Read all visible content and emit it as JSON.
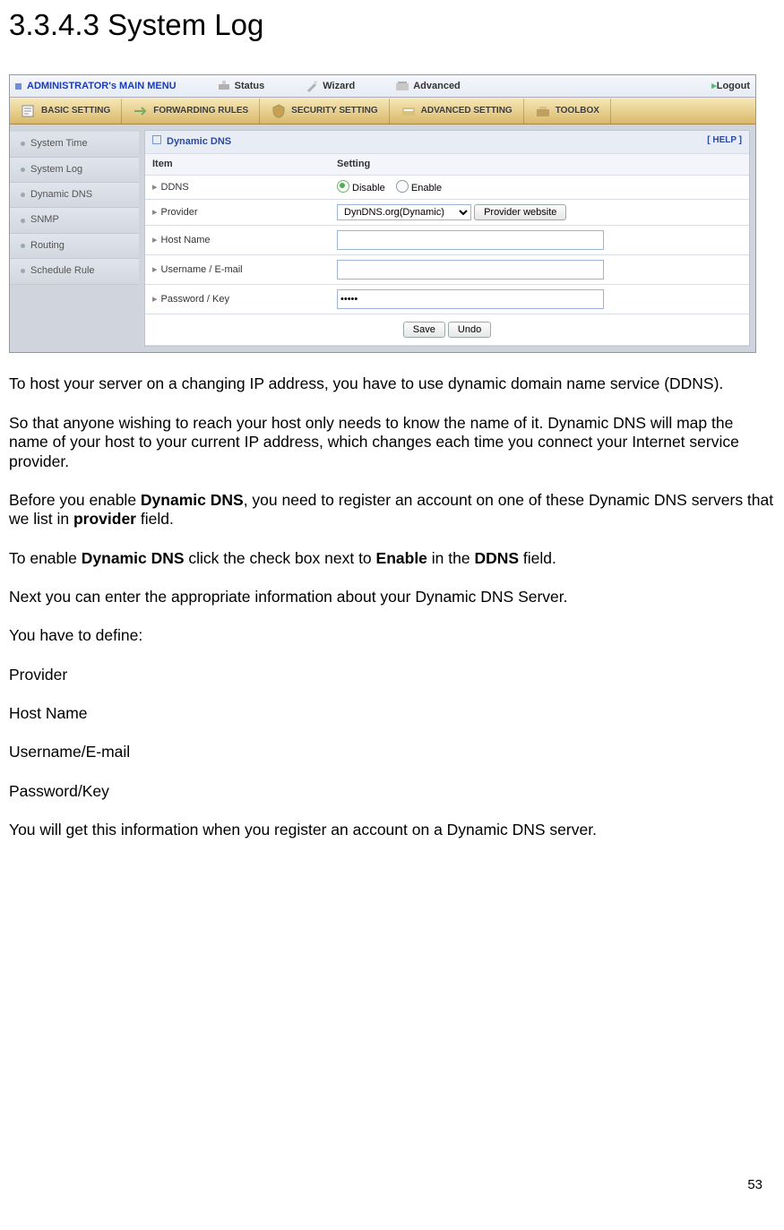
{
  "heading": "3.3.4.3 System Log",
  "topbar": {
    "title": "ADMINISTRATOR's MAIN MENU",
    "nav": {
      "status": "Status",
      "wizard": "Wizard",
      "advanced": "Advanced"
    },
    "logout": "Logout"
  },
  "tabs": {
    "basic": "BASIC SETTING",
    "forwarding": "FORWARDING RULES",
    "security": "SECURITY SETTING",
    "advanced": "ADVANCED SETTING",
    "toolbox": "TOOLBOX"
  },
  "sidebar": {
    "items": [
      "System Time",
      "System Log",
      "Dynamic DNS",
      "SNMP",
      "Routing",
      "Schedule Rule"
    ]
  },
  "panel": {
    "title": "Dynamic DNS",
    "help": "[ HELP ]",
    "col_item": "Item",
    "col_setting": "Setting",
    "rows": {
      "ddns": "DDNS",
      "provider": "Provider",
      "hostname": "Host Name",
      "username": "Username / E-mail",
      "password": "Password / Key"
    },
    "radio_disable": "Disable",
    "radio_enable": "Enable",
    "provider_value": "DynDNS.org(Dynamic)",
    "provider_btn": "Provider website",
    "hostname_value": "",
    "username_value": "",
    "password_value": "•••••",
    "save": "Save",
    "undo": "Undo"
  },
  "prose": {
    "p1": "To host your server on a changing IP address, you have to use dynamic domain name service (DDNS).",
    "p2": "So that anyone wishing to reach your host only needs to know the name of it. Dynamic DNS will map the name of your host to your current IP address, which changes each time you connect your Internet service provider.",
    "p3a": "Before you enable ",
    "p3b": "Dynamic DNS",
    "p3c": ", you need to register an account on one of these Dynamic DNS servers that we list in ",
    "p3d": "provider",
    "p3e": " field.",
    "p4a": "To enable ",
    "p4b": "Dynamic DNS",
    "p4c": " click the check box next to ",
    "p4d": "Enable",
    "p4e": " in the ",
    "p4f": "DDNS",
    "p4g": " field.",
    "p5": "Next you can enter the appropriate information about your Dynamic DNS Server.",
    "p6": "You have to define:",
    "l1": "Provider",
    "l2": "Host Name",
    "l3": "Username/E-mail",
    "l4": "Password/Key",
    "p7": "You will get this information when you register an account on a Dynamic DNS server."
  },
  "page_number": "53"
}
